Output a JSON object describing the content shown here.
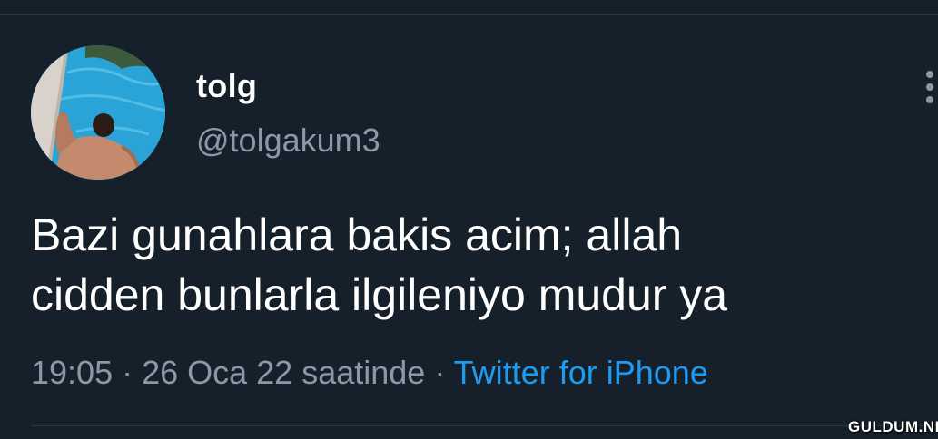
{
  "tweet": {
    "display_name": "tolg",
    "handle": "@tolgakum3",
    "text_lines": [
      "Bazi gunahlara bakis acim; allah",
      "cidden bunlarla ilgileniyo mudur ya"
    ],
    "time": "19:05",
    "separator": " · ",
    "date": "26 Oca 22 saatinde",
    "source": "Twitter for iPhone"
  },
  "icons": {
    "more": "more-vertical-icon",
    "avatar": "profile-photo"
  },
  "colors": {
    "background": "#15202b",
    "primary_text": "#ffffff",
    "secondary_text": "#8b98a5",
    "link": "#1d9bf0",
    "divider": "#2a3945"
  },
  "watermark": {
    "text": "GULDUM.NET"
  }
}
